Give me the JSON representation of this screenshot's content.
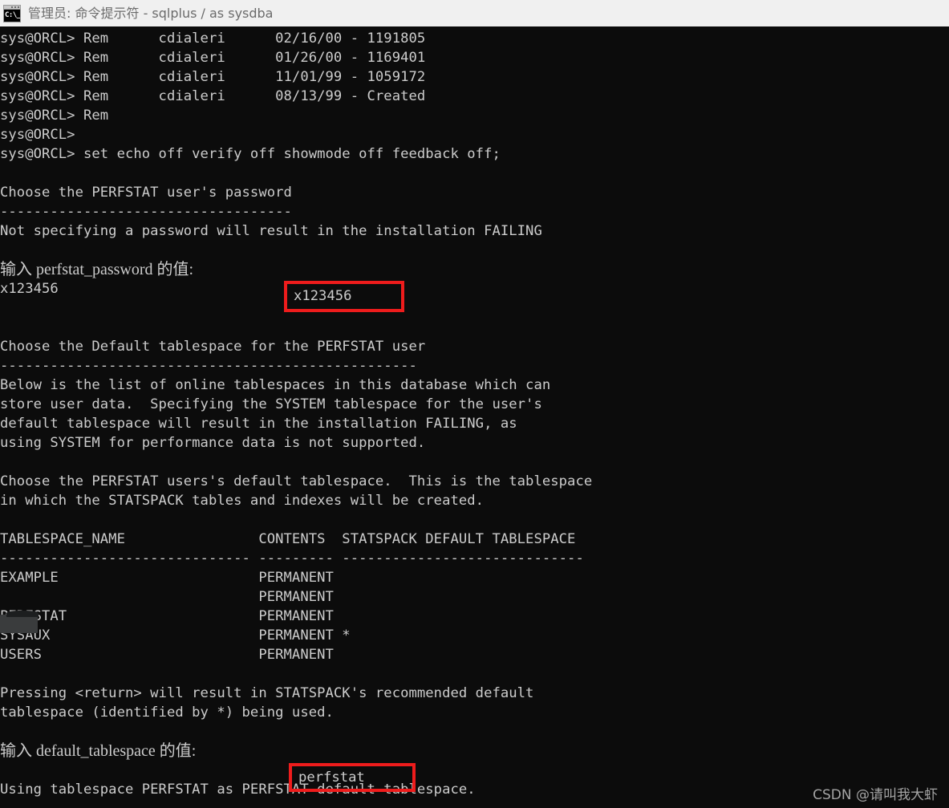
{
  "window": {
    "title": "管理员: 命令提示符 - sqlplus  / as sysdba",
    "icon": "cmd-console-icon",
    "icon_glyph": "C:\\_",
    "titlebar_color": "#f0f0f0",
    "console_bg": "#0c0c0c",
    "console_fg": "#cccccc"
  },
  "annotations": {
    "highlight_color": "#ee1c1c",
    "boxes": [
      {
        "name": "password-value-box",
        "value": "x123456"
      },
      {
        "name": "default-tablespace-value-box",
        "value": "perfstat"
      }
    ],
    "redaction": {
      "name": "redacted-tablespace-name",
      "color": "#3a3c3d"
    }
  },
  "watermark": {
    "text": "CSDN @请叫我大虾"
  },
  "console": {
    "lines": [
      "sys@ORCL> Rem      cdialeri      02/16/00 - 1191805",
      "sys@ORCL> Rem      cdialeri      01/26/00 - 1169401",
      "sys@ORCL> Rem      cdialeri      11/01/99 - 1059172",
      "sys@ORCL> Rem      cdialeri      08/13/99 - Created",
      "sys@ORCL> Rem",
      "sys@ORCL>",
      "sys@ORCL> set echo off verify off showmode off feedback off;",
      "",
      "Choose the PERFSTAT user's password",
      "-----------------------------------",
      "Not specifying a password will result in the installation FAILING",
      "",
      "输入 perfstat_password 的值:",
      "x123456",
      "",
      "",
      "Choose the Default tablespace for the PERFSTAT user",
      "--------------------------------------------------",
      "Below is the list of online tablespaces in this database which can",
      "store user data.  Specifying the SYSTEM tablespace for the user's",
      "default tablespace will result in the installation FAILING, as",
      "using SYSTEM for performance data is not supported.",
      "",
      "Choose the PERFSTAT users's default tablespace.  This is the tablespace",
      "in which the STATSPACK tables and indexes will be created.",
      "",
      "TABLESPACE_NAME                CONTENTS  STATSPACK DEFAULT TABLESPACE",
      "------------------------------ --------- -----------------------------",
      "EXAMPLE                        PERMANENT",
      "                               PERMANENT",
      "PERFSTAT                       PERMANENT",
      "SYSAUX                         PERMANENT *",
      "USERS                          PERMANENT",
      "",
      "Pressing <return> will result in STATSPACK's recommended default",
      "tablespace (identified by *) being used.",
      "",
      "输入 default_tablespace 的值:",
      "",
      "Using tablespace PERFSTAT as PERFSTAT default tablespace."
    ],
    "prompt_rows": {
      "password_prompt_label": "输入 perfstat_password 的值:",
      "password_entered_value": "x123456",
      "password_echo": "x123456",
      "tablespace_prompt_label": "输入 default_tablespace 的值:",
      "tablespace_entered_value": "perfstat"
    },
    "tablespace_table": {
      "headers": [
        "TABLESPACE_NAME",
        "CONTENTS",
        "STATSPACK DEFAULT TABLESPACE"
      ],
      "rows": [
        {
          "name": "EXAMPLE",
          "contents": "PERMANENT",
          "default_marker": ""
        },
        {
          "name": "",
          "contents": "PERMANENT",
          "default_marker": ""
        },
        {
          "name": "PERFSTAT",
          "contents": "PERMANENT",
          "default_marker": ""
        },
        {
          "name": "SYSAUX",
          "contents": "PERMANENT",
          "default_marker": "*"
        },
        {
          "name": "USERS",
          "contents": "PERMANENT",
          "default_marker": ""
        }
      ]
    }
  }
}
